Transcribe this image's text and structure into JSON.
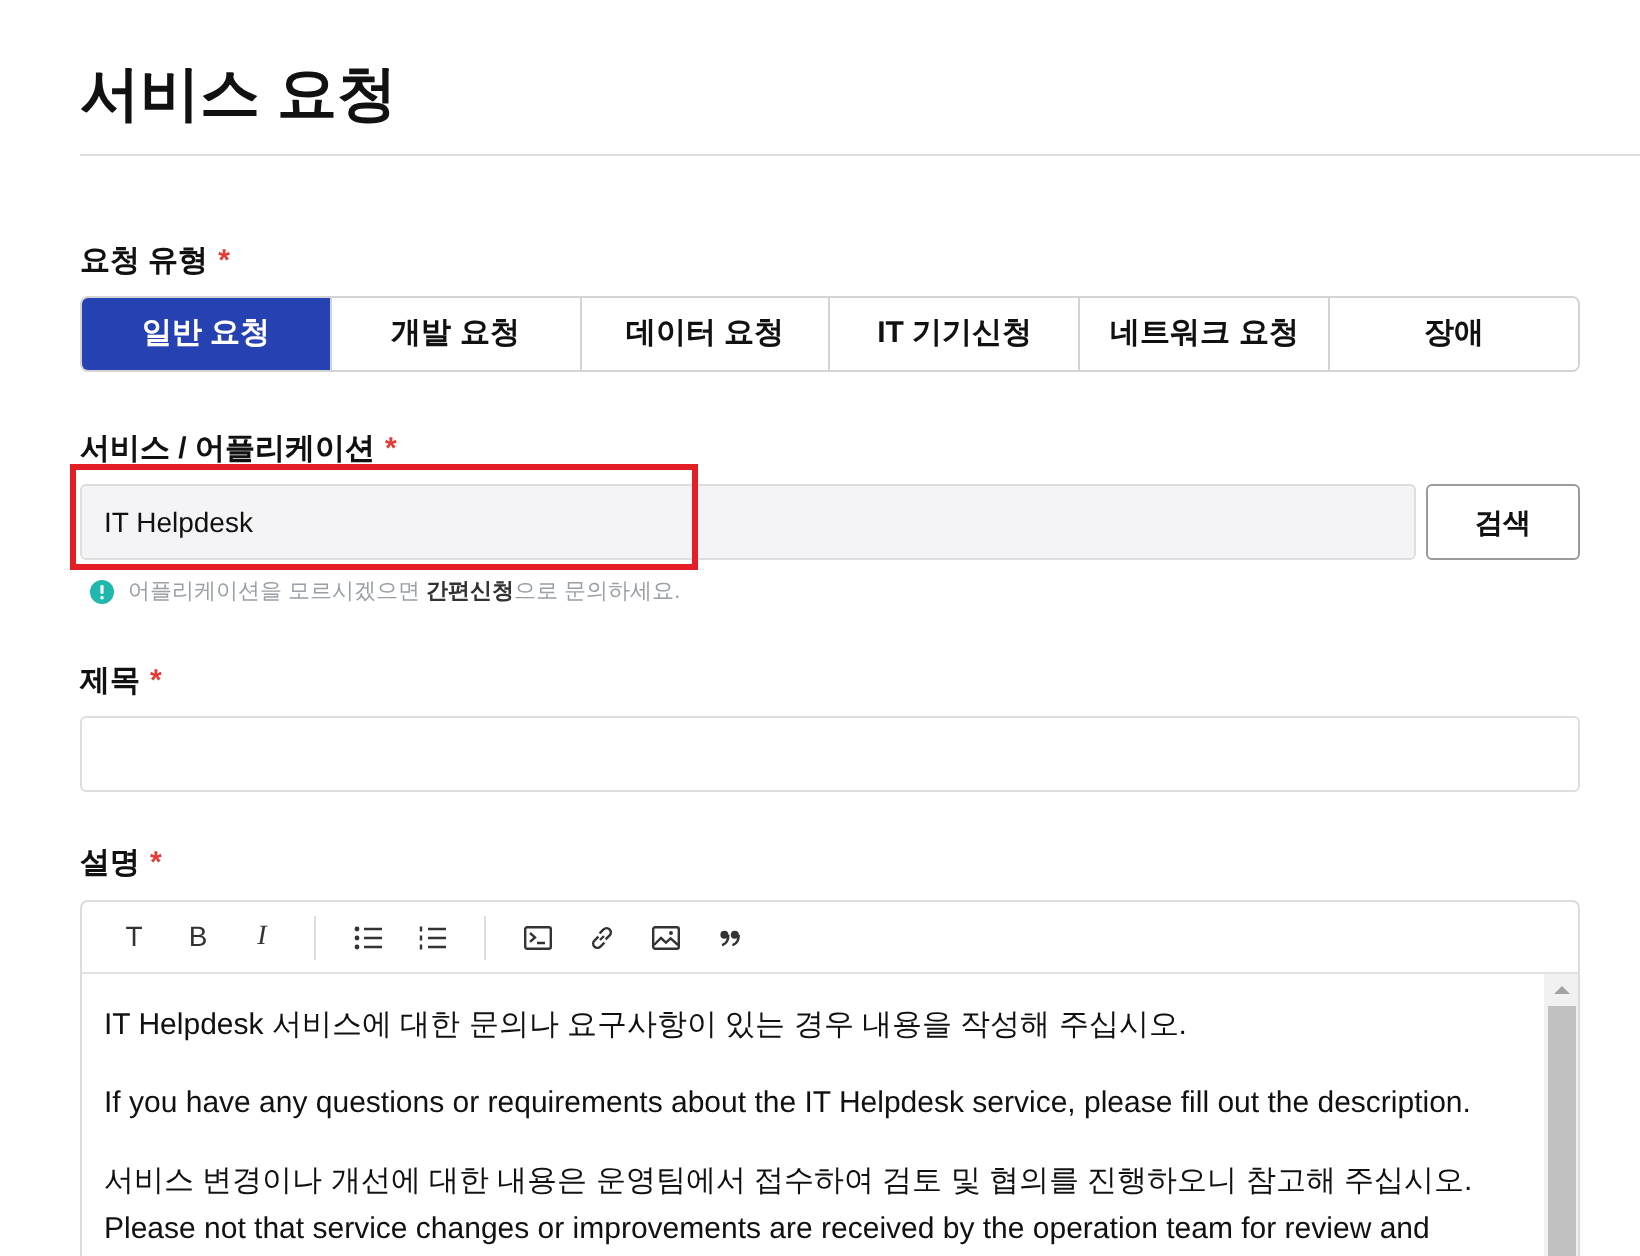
{
  "page": {
    "title": "서비스 요청"
  },
  "request_type": {
    "label": "요청 유형",
    "required_mark": "*",
    "options": [
      {
        "label": "일반 요청",
        "selected": true
      },
      {
        "label": "개발 요청",
        "selected": false
      },
      {
        "label": "데이터 요청",
        "selected": false
      },
      {
        "label": "IT 기기신청",
        "selected": false
      },
      {
        "label": "네트워크 요청",
        "selected": false
      },
      {
        "label": "장애",
        "selected": false
      }
    ]
  },
  "service": {
    "label": "서비스 / 어플리케이션",
    "required_mark": "*",
    "value": "IT Helpdesk",
    "highlighted": true,
    "button": "검색",
    "hint": "어플리케이션을 모르시겠으면 **간편신청**으로 문의하세요."
  },
  "subject": {
    "label": "제목",
    "required_mark": "*"
  },
  "description": {
    "label": "설명",
    "required_mark": "*",
    "toolbar": {
      "format_buttons": [
        "T",
        "B",
        "I"
      ]
    },
    "paragraphs": [
      {
        "lines": [
          "IT Helpdesk 서비스에 대한 문의나 요구사항이 있는 경우 내용을 작성해 주십시오."
        ]
      },
      {
        "lines": [
          "If you have any questions or requirements about the IT Helpdesk service, please fill out the description."
        ]
      },
      {
        "lines": [
          "서비스 변경이나 개선에 대한 내용은 운영팀에서 접수하여 검토 및 협의를 진행하오니 참고해 주십시오.",
          "Please not that service changes or improvements are received by the operation team for review and"
        ]
      }
    ]
  }
}
